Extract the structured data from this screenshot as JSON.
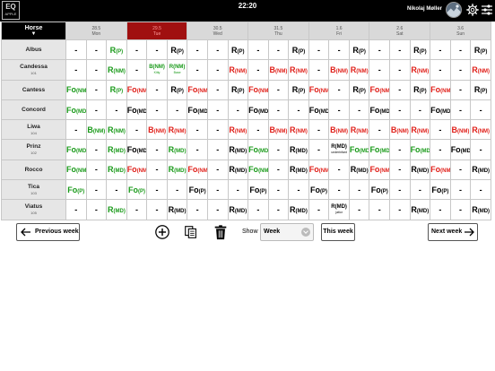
{
  "topbar": {
    "logo_top": "EQ",
    "logo_bottom": "APPLE",
    "time": "22:20",
    "user": "Nikolaj Møller"
  },
  "header": {
    "horse_label": "Horse",
    "sort_glyph": "▼",
    "days": [
      {
        "date": "28.5",
        "day": "Mon",
        "today": false
      },
      {
        "date": "29.5",
        "day": "Tue",
        "today": true
      },
      {
        "date": "30.5",
        "day": "Wed",
        "today": false
      },
      {
        "date": "31.5",
        "day": "Thu",
        "today": false
      },
      {
        "date": "1.6",
        "day": "Fri",
        "today": false
      },
      {
        "date": "2.6",
        "day": "Sat",
        "today": false
      },
      {
        "date": "3.6",
        "day": "Sun",
        "today": false
      }
    ]
  },
  "rows": [
    {
      "name": "Albus",
      "num": "",
      "cells": [
        {
          "t": "-"
        },
        {
          "t": "-"
        },
        {
          "t": "R",
          "s": "(P)",
          "c": "g"
        },
        {
          "t": "-"
        },
        {
          "t": "-"
        },
        {
          "t": "R",
          "s": "(P)",
          "c": "k"
        },
        {
          "t": "-"
        },
        {
          "t": "-"
        },
        {
          "t": "R",
          "s": "(P)",
          "c": "k"
        },
        {
          "t": "-"
        },
        {
          "t": "-"
        },
        {
          "t": "R",
          "s": "(P)",
          "c": "k"
        },
        {
          "t": "-"
        },
        {
          "t": "-"
        },
        {
          "t": "R",
          "s": "(P)",
          "c": "k"
        },
        {
          "t": "-"
        },
        {
          "t": "-"
        },
        {
          "t": "R",
          "s": "(P)",
          "c": "k"
        },
        {
          "t": "-"
        },
        {
          "t": "-"
        },
        {
          "t": "R",
          "s": "(P)",
          "c": "k"
        }
      ]
    },
    {
      "name": "Candessa",
      "num": "101",
      "cells": [
        {
          "t": "-"
        },
        {
          "t": "-"
        },
        {
          "t": "R",
          "s": "(NM)",
          "c": "g"
        },
        {
          "t": "-"
        },
        {
          "mini": true,
          "t": "B(NM)",
          "s": "Kitty",
          "c": "g"
        },
        {
          "mini": true,
          "t": "R(NM)",
          "s": "Base",
          "c": "g"
        },
        {
          "t": "-"
        },
        {
          "t": "-"
        },
        {
          "t": "R",
          "s": "(NM)",
          "c": "r"
        },
        {
          "t": "-"
        },
        {
          "t": "B",
          "s": "(NM)",
          "c": "r"
        },
        {
          "t": "R",
          "s": "(NM)",
          "c": "r"
        },
        {
          "t": "-"
        },
        {
          "t": "B",
          "s": "(NM)",
          "c": "r"
        },
        {
          "t": "R",
          "s": "(NM)",
          "c": "r"
        },
        {
          "t": "-"
        },
        {
          "t": "-"
        },
        {
          "t": "R",
          "s": "(NM)",
          "c": "r"
        },
        {
          "t": "-"
        },
        {
          "t": "-"
        },
        {
          "t": "R",
          "s": "(NM)",
          "c": "r"
        }
      ]
    },
    {
      "name": "Cantess",
      "num": "",
      "cells": [
        {
          "t": "Fo",
          "s": "(NM)",
          "c": "g"
        },
        {
          "t": "-"
        },
        {
          "t": "R",
          "s": "(P)",
          "c": "g"
        },
        {
          "t": "Fo",
          "s": "(NM)",
          "c": "r"
        },
        {
          "t": "-"
        },
        {
          "t": "R",
          "s": "(P)",
          "c": "k"
        },
        {
          "t": "Fo",
          "s": "(NM)",
          "c": "r"
        },
        {
          "t": "-"
        },
        {
          "t": "R",
          "s": "(P)",
          "c": "k"
        },
        {
          "t": "Fo",
          "s": "(NM)",
          "c": "r"
        },
        {
          "t": "-"
        },
        {
          "t": "R",
          "s": "(P)",
          "c": "k"
        },
        {
          "t": "Fo",
          "s": "(NM)",
          "c": "r"
        },
        {
          "t": "-"
        },
        {
          "t": "R",
          "s": "(P)",
          "c": "k"
        },
        {
          "t": "Fo",
          "s": "(NM)",
          "c": "r"
        },
        {
          "t": "-"
        },
        {
          "t": "R",
          "s": "(P)",
          "c": "k"
        },
        {
          "t": "Fo",
          "s": "(NM)",
          "c": "r"
        },
        {
          "t": "-"
        },
        {
          "t": "R",
          "s": "(P)",
          "c": "k"
        }
      ]
    },
    {
      "name": "Concord",
      "num": "",
      "cells": [
        {
          "t": "Fo",
          "s": "(MD)",
          "c": "g"
        },
        {
          "t": "-"
        },
        {
          "t": "-"
        },
        {
          "t": "Fo",
          "s": "(MD)",
          "c": "k"
        },
        {
          "t": "-"
        },
        {
          "t": "-"
        },
        {
          "t": "Fo",
          "s": "(MD)",
          "c": "k"
        },
        {
          "t": "-"
        },
        {
          "t": "-"
        },
        {
          "t": "Fo",
          "s": "(MD)",
          "c": "k"
        },
        {
          "t": "-"
        },
        {
          "t": "-"
        },
        {
          "t": "Fo",
          "s": "(MD)",
          "c": "k"
        },
        {
          "t": "-"
        },
        {
          "t": "-"
        },
        {
          "t": "Fo",
          "s": "(MD)",
          "c": "k"
        },
        {
          "t": "-"
        },
        {
          "t": "-"
        },
        {
          "t": "Fo",
          "s": "(MD)",
          "c": "k"
        },
        {
          "t": "-"
        },
        {
          "t": "-"
        }
      ]
    },
    {
      "name": "Liwa",
      "num": "104",
      "cells": [
        {
          "t": "-"
        },
        {
          "t": "B",
          "s": "(NM)",
          "c": "g"
        },
        {
          "t": "R",
          "s": "(NM)",
          "c": "g"
        },
        {
          "t": "-"
        },
        {
          "t": "B",
          "s": "(NM)",
          "c": "r"
        },
        {
          "t": "R",
          "s": "(NM)",
          "c": "r"
        },
        {
          "t": "-"
        },
        {
          "t": "-"
        },
        {
          "t": "R",
          "s": "(NM)",
          "c": "r"
        },
        {
          "t": "-"
        },
        {
          "t": "B",
          "s": "(NM)",
          "c": "r"
        },
        {
          "t": "R",
          "s": "(NM)",
          "c": "r"
        },
        {
          "t": "-"
        },
        {
          "t": "B",
          "s": "(NM)",
          "c": "r"
        },
        {
          "t": "R",
          "s": "(NM)",
          "c": "r"
        },
        {
          "t": "-"
        },
        {
          "t": "B",
          "s": "(NM)",
          "c": "r"
        },
        {
          "t": "R",
          "s": "(NM)",
          "c": "r"
        },
        {
          "t": "-"
        },
        {
          "t": "B",
          "s": "(NM)",
          "c": "r"
        },
        {
          "t": "R",
          "s": "(NM)",
          "c": "r"
        }
      ]
    },
    {
      "name": "Prinz",
      "num": "102",
      "cells": [
        {
          "t": "Fo",
          "s": "(MD)",
          "c": "g"
        },
        {
          "t": "-"
        },
        {
          "t": "R",
          "s": "(MD)",
          "c": "g"
        },
        {
          "t": "Fo",
          "s": "(MD)",
          "c": "k"
        },
        {
          "t": "-"
        },
        {
          "t": "R",
          "s": "(MD)",
          "c": "g"
        },
        {
          "t": "-"
        },
        {
          "t": "-"
        },
        {
          "t": "R",
          "s": "(MD)",
          "c": "k"
        },
        {
          "t": "Fo",
          "s": "(MD)",
          "c": "g"
        },
        {
          "t": "-"
        },
        {
          "t": "R",
          "s": "(MD)",
          "c": "k"
        },
        {
          "t": "-"
        },
        {
          "mini": true,
          "t": "R(MD)",
          "s": "underinfant",
          "c": "k"
        },
        {
          "t": "Fo",
          "s": "(MD)",
          "c": "g"
        },
        {
          "t": "Fo",
          "s": "(MD)",
          "c": "g"
        },
        {
          "t": "-"
        },
        {
          "t": "Fo",
          "s": "(MD)",
          "c": "g"
        },
        {
          "t": "-"
        },
        {
          "t": "Fo",
          "s": "(MD)",
          "c": "k"
        },
        {
          "t": "-"
        }
      ]
    },
    {
      "name": "Rocco",
      "num": "",
      "cells": [
        {
          "t": "Fo",
          "s": "(NM)",
          "c": "g"
        },
        {
          "t": "-"
        },
        {
          "t": "R",
          "s": "(MD)",
          "c": "g"
        },
        {
          "t": "Fo",
          "s": "(NM)",
          "c": "r"
        },
        {
          "t": "-"
        },
        {
          "t": "R",
          "s": "(MD)",
          "c": "g"
        },
        {
          "t": "Fo",
          "s": "(NM)",
          "c": "r"
        },
        {
          "t": "-"
        },
        {
          "t": "R",
          "s": "(MD)",
          "c": "k"
        },
        {
          "t": "Fo",
          "s": "(NM)",
          "c": "g"
        },
        {
          "t": "-"
        },
        {
          "t": "R",
          "s": "(MD)",
          "c": "k"
        },
        {
          "t": "Fo",
          "s": "(NM)",
          "c": "r"
        },
        {
          "t": "-"
        },
        {
          "t": "R",
          "s": "(MD)",
          "c": "k"
        },
        {
          "t": "Fo",
          "s": "(NM)",
          "c": "r"
        },
        {
          "t": "-"
        },
        {
          "t": "R",
          "s": "(MD)",
          "c": "k"
        },
        {
          "t": "Fo",
          "s": "(NM)",
          "c": "r"
        },
        {
          "t": "-"
        },
        {
          "t": "R",
          "s": "(MD)",
          "c": "k"
        }
      ]
    },
    {
      "name": "Tica",
      "num": "103",
      "cells": [
        {
          "t": "Fo",
          "s": "(P)",
          "c": "g"
        },
        {
          "t": "-"
        },
        {
          "t": "-"
        },
        {
          "t": "Fo",
          "s": "(P)",
          "c": "g"
        },
        {
          "t": "-"
        },
        {
          "t": "-"
        },
        {
          "t": "Fo",
          "s": "(P)",
          "c": "k"
        },
        {
          "t": "-"
        },
        {
          "t": "-"
        },
        {
          "t": "Fo",
          "s": "(P)",
          "c": "k"
        },
        {
          "t": "-"
        },
        {
          "t": "-"
        },
        {
          "t": "Fo",
          "s": "(P)",
          "c": "k"
        },
        {
          "t": "-"
        },
        {
          "t": "-"
        },
        {
          "t": "Fo",
          "s": "(P)",
          "c": "k"
        },
        {
          "t": "-"
        },
        {
          "t": "-"
        },
        {
          "t": "Fo",
          "s": "(P)",
          "c": "k"
        },
        {
          "t": "-"
        },
        {
          "t": "-"
        }
      ]
    },
    {
      "name": "Viatus",
      "num": "105",
      "cells": [
        {
          "t": "-"
        },
        {
          "t": "-"
        },
        {
          "t": "R",
          "s": "(MD)",
          "c": "g"
        },
        {
          "t": "-"
        },
        {
          "t": "-"
        },
        {
          "t": "R",
          "s": "(MD)",
          "c": "k"
        },
        {
          "t": "-"
        },
        {
          "t": "-"
        },
        {
          "t": "R",
          "s": "(MD)",
          "c": "k"
        },
        {
          "t": "-"
        },
        {
          "t": "-"
        },
        {
          "t": "R",
          "s": "(MD)",
          "c": "k"
        },
        {
          "t": "-"
        },
        {
          "mini": true,
          "t": "R(MD)",
          "s": "jatior",
          "c": "k"
        },
        {
          "t": "-"
        },
        {
          "t": "-"
        },
        {
          "t": "-"
        },
        {
          "t": "R",
          "s": "(MD)",
          "c": "k"
        },
        {
          "t": "-"
        },
        {
          "t": "-"
        },
        {
          "t": "R",
          "s": "(MD)",
          "c": "k"
        }
      ]
    }
  ],
  "bottom": {
    "prev_label": "Previous week",
    "next_label": "Next week",
    "show_label": "Show",
    "show_value": "Week",
    "this_week_label": "This week"
  },
  "icons": {
    "add": "add-circle-icon",
    "copy": "copy-icon",
    "delete": "trash-icon",
    "settings": "gear-icon",
    "menu": "sliders-icon"
  },
  "colors": {
    "green": "#1a9a1a",
    "red": "#e0201a",
    "today_header": "#a01010",
    "header_bg": "#d9d9d9",
    "topbar_bg": "#000000"
  }
}
